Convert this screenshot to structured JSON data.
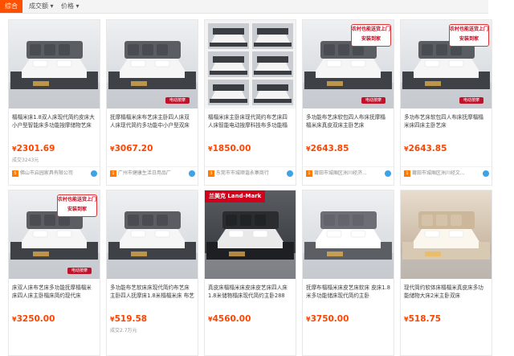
{
  "sort_bar": {
    "items": [
      {
        "label": "综合",
        "active": true
      },
      {
        "label": "成交额 ▾",
        "active": false
      },
      {
        "label": "价格 ▾",
        "active": false
      }
    ]
  },
  "accent_color": "#ff5000",
  "price_color": "#ff4400",
  "products": [
    {
      "title": "榻榻米床1.8双人床现代简约皮床大小户型智能床多功能按摩储物艺床",
      "price_symbol": "¥",
      "price": "2301.69",
      "sales": "成交3243元",
      "store_years": "5",
      "store": "佛山市启园家具有限公司",
      "image_overlay": "",
      "image_tag": "",
      "image_promo": ""
    },
    {
      "title": "抚摩榻榻米床布艺床主卧四人床双人床现代简约多功能中小户型双床榻床",
      "price_symbol": "¥",
      "price": "3067.20",
      "sales": "",
      "store_years": "1",
      "store": "广州市健康生活日用品厂",
      "image_overlay": "",
      "image_tag": "电动按摩",
      "image_promo": ""
    },
    {
      "title": "榻榻米床主卧床现代简约布艺床四人床智能电动按摩科技布多功能榻榻床",
      "price_symbol": "¥",
      "price": "1850.00",
      "sales": "",
      "store_years": "3",
      "store": "东莞市市城顺谐永寨商行",
      "image_overlay": "",
      "image_tag": "",
      "image_promo": ""
    },
    {
      "title": "多功能布艺床软包四人布床抚摩榻榻米床真皮双床主卧艺床",
      "price_symbol": "¥",
      "price": "2643.85",
      "sales": "",
      "store_years": "1",
      "store": "莆田市城厢区洲川经济...",
      "image_overlay": "农村也能送货上门安装到家",
      "image_tag": "电动按摩",
      "image_promo": ""
    },
    {
      "title": "多功布艺床软包四人布床抚摩榻榻米床四床主卧艺床",
      "price_symbol": "¥",
      "price": "2643.85",
      "sales": "",
      "store_years": "1",
      "store": "莆田市城厢区洲川经文...",
      "image_overlay": "农村也能送货上门安装到家",
      "image_tag": "电动按摩",
      "image_promo": ""
    },
    {
      "title": "床双人床布艺床多功能抚摩榻榻米床四人床主卧榻床简约现代床",
      "price_symbol": "¥",
      "price": "3250.00",
      "sales": "",
      "store_years": "",
      "store": "",
      "image_overlay": "农村也能送货上门安装到家",
      "image_tag": "电动按摩",
      "image_promo": ""
    },
    {
      "title": "多功能布艺软床床现代简约布艺床主卧四人抚摩床1.8米榻榻米床 布艺床",
      "price_symbol": "¥",
      "price": "519.58",
      "sales": "成交2.7万元",
      "store_years": "",
      "store": "",
      "image_overlay": "",
      "image_tag": "",
      "image_promo": ""
    },
    {
      "title": "真皮床榻榻米床皮床皮艺床四人床1.8米储物榻床现代简约主卧288",
      "price_symbol": "¥",
      "price": "4560.00",
      "sales": "",
      "store_years": "",
      "store": "",
      "image_overlay": "",
      "image_tag": "",
      "image_promo": "兰美克 Land-Mark"
    },
    {
      "title": "抚摩布榻榻米床皮艺床软床 皮床1.8米多功能储床现代简约主卧",
      "price_symbol": "¥",
      "price": "3750.00",
      "sales": "",
      "store_years": "",
      "store": "",
      "image_overlay": "",
      "image_tag": "",
      "image_promo": ""
    },
    {
      "title": "现代简约软体床榻榻米真皮床多功能储物大床2米主卧双床",
      "price_symbol": "¥",
      "price": "518.75",
      "sales": "",
      "store_years": "",
      "store": "",
      "image_overlay": "",
      "image_tag": "",
      "image_promo": ""
    }
  ]
}
